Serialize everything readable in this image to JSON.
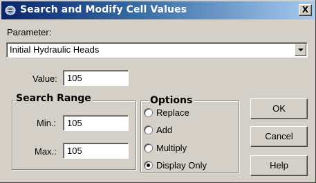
{
  "window": {
    "title": "Search and Modify Cell Values",
    "icon": "app-icon",
    "close_label": "X"
  },
  "parameter": {
    "label": "Parameter:",
    "selected": "Initial Hydraulic Heads"
  },
  "value": {
    "label": "Value:",
    "input": "105"
  },
  "search_range": {
    "title": "Search Range",
    "min_label": "Min.:",
    "min_value": "105",
    "max_label": "Max.:",
    "max_value": "105"
  },
  "options": {
    "title": "Options",
    "items": [
      {
        "label": "Replace",
        "checked": false
      },
      {
        "label": "Add",
        "checked": false
      },
      {
        "label": "Multiply",
        "checked": false
      },
      {
        "label": "Display Only",
        "checked": true
      }
    ]
  },
  "buttons": {
    "ok": "OK",
    "cancel": "Cancel",
    "help": "Help"
  }
}
